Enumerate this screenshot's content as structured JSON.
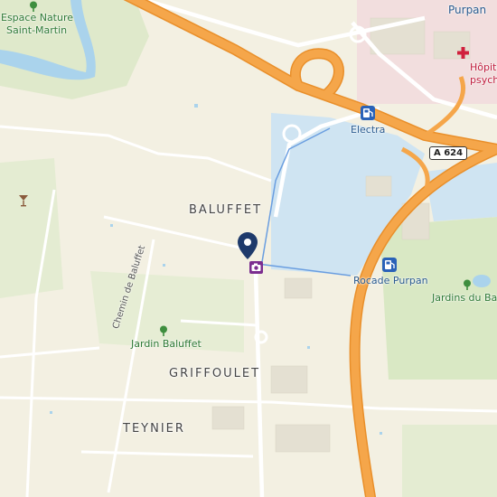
{
  "map": {
    "districts": {
      "baluffet": "BALUFFET",
      "griffoulet": "GRIFFOULET",
      "teynier": "TEYNIER"
    },
    "places": {
      "espace_nature_line1": "Espace Nature",
      "espace_nature_line2": "Saint-Martin",
      "jardin_baluffet": "Jardin Baluffet",
      "jardins_du_bar": "Jardins du Bar",
      "purpan": "Purpan",
      "hopital_line1": "Hôpita",
      "hopital_line2": "psych"
    },
    "pois": {
      "electra": "Electra",
      "rocade_purpan": "Rocade Purpan"
    },
    "streets": {
      "chemin_de_baluffet": "Chemin de Baluffet"
    },
    "road_shield": "A 624",
    "colors": {
      "motorway": "#f5a64a",
      "water": "#cfe4f2",
      "park": "#d9e8c4",
      "marker": "#1e3a6b",
      "camera": "#7b2d8f",
      "fuel": "#2a62b8"
    },
    "icons": {
      "location_pin": "map-pin-icon",
      "camera": "camera-icon",
      "fuel": "fuel-icon",
      "tree": "tree-icon",
      "bar": "cocktail-icon",
      "hospital": "hospital-cross-icon"
    }
  }
}
